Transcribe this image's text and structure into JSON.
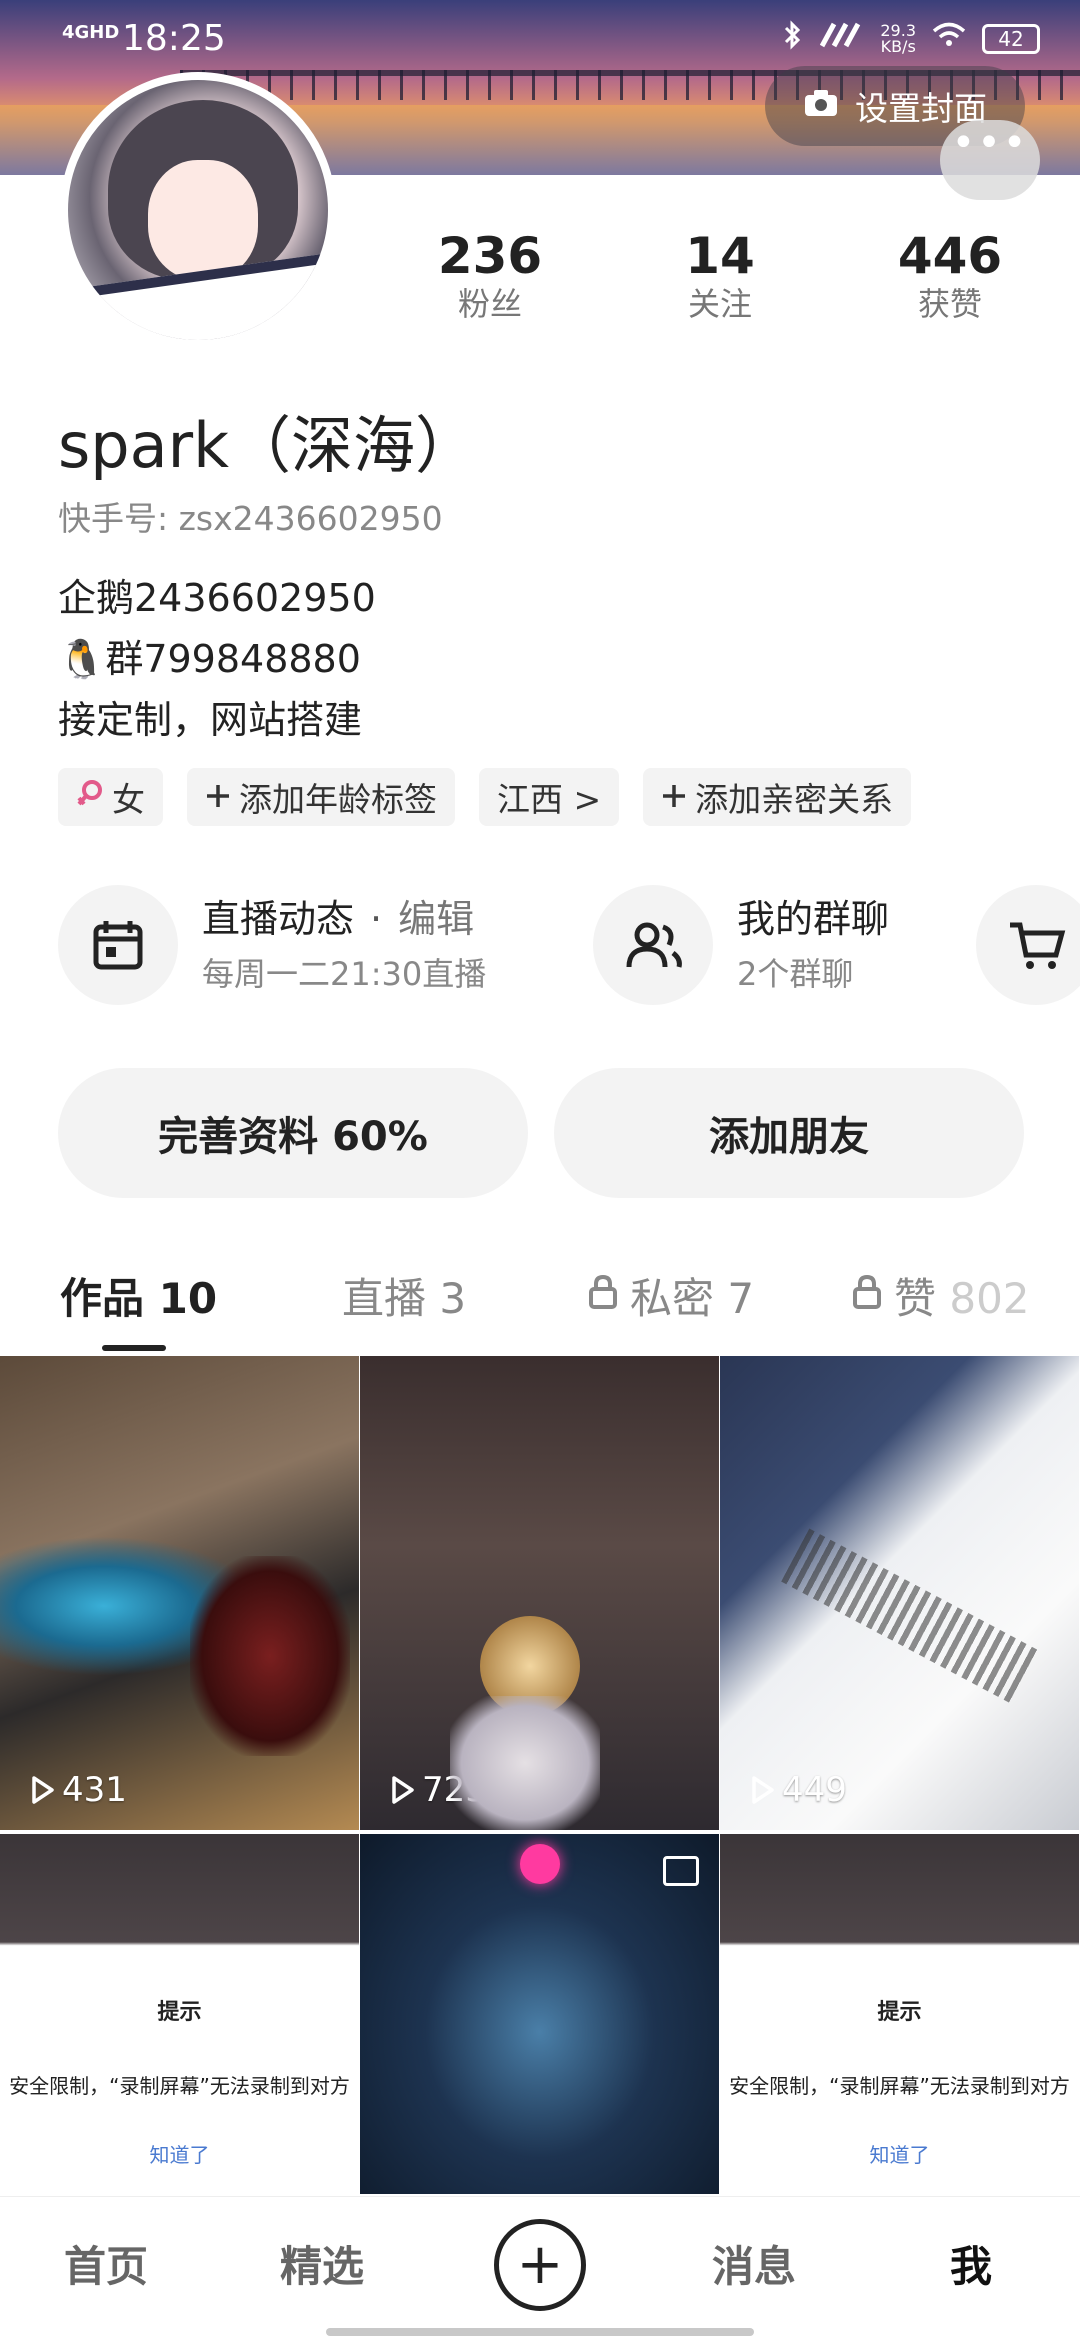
{
  "statusbar": {
    "network": "4GHD",
    "time": "18:25",
    "speed_value": "29.3",
    "speed_unit": "KB/s",
    "battery": "42"
  },
  "cover": {
    "set_cover_label": "设置封面",
    "more_label": "•••"
  },
  "stats": [
    {
      "value": "236",
      "label": "粉丝"
    },
    {
      "value": "14",
      "label": "关注"
    },
    {
      "value": "446",
      "label": "获赞"
    }
  ],
  "profile": {
    "name": "spark（深海）",
    "uid": "快手号: zsx2436602950",
    "bio_lines": [
      "企鹅2436602950",
      "🐧群799848880",
      "接定制，网站搭建"
    ]
  },
  "tags": {
    "gender": "女",
    "age": "添加年龄标签",
    "region": "江西 >",
    "relation": "添加亲密关系"
  },
  "entries": {
    "live": {
      "title": "直播动态",
      "edit": "编辑",
      "subtitle": "每周一二21:30直播"
    },
    "groups": {
      "title": "我的群聊",
      "subtitle": "2个群聊"
    }
  },
  "buttons": {
    "complete_profile": "完善资料 60%",
    "add_friend": "添加朋友"
  },
  "tabs": {
    "works": "作品 10",
    "live": "直播 3",
    "private": "私密 7",
    "likes_prefix": "赞 ",
    "likes_count": "802"
  },
  "videos": [
    {
      "plays": "431"
    },
    {
      "plays": "723"
    },
    {
      "plays": "449"
    }
  ],
  "dialog": {
    "title": "提示",
    "message": "安全限制，“录制屏幕”无法录制到对方",
    "ok": "知道了"
  },
  "bottomnav": {
    "home": "首页",
    "featured": "精选",
    "plus": "+",
    "messages": "消息",
    "me": "我"
  }
}
